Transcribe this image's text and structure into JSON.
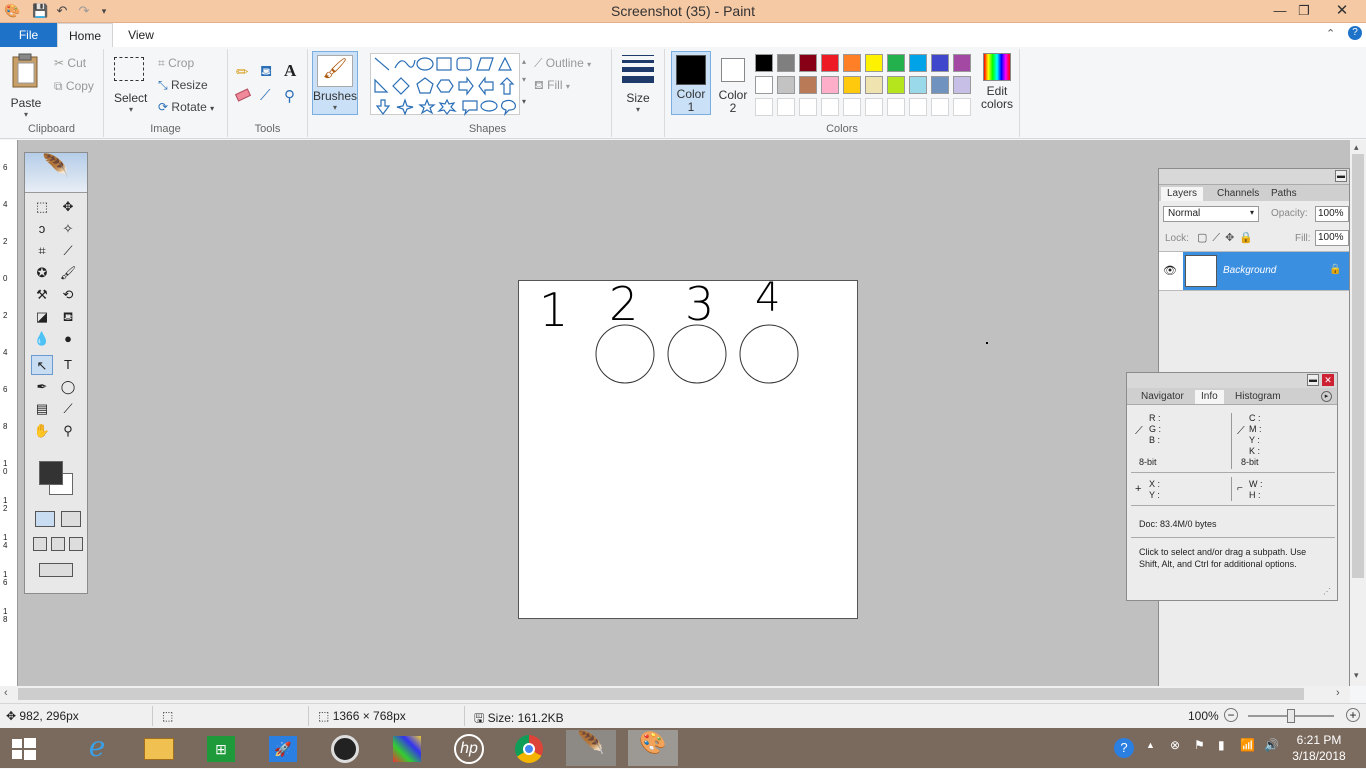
{
  "window": {
    "title": "Screenshot (35) - Paint"
  },
  "tabs": {
    "file": "File",
    "home": "Home",
    "view": "View"
  },
  "clipboard": {
    "paste": "Paste",
    "cut": "Cut",
    "copy": "Copy",
    "group": "Clipboard"
  },
  "image": {
    "select": "Select",
    "crop": "Crop",
    "resize": "Resize",
    "rotate": "Rotate",
    "group": "Image"
  },
  "tools": {
    "group": "Tools",
    "brushes": "Brushes"
  },
  "shapes": {
    "outline": "Outline",
    "fill": "Fill",
    "group": "Shapes"
  },
  "size": {
    "label": "Size"
  },
  "colors": {
    "color1_a": "Color",
    "color1_b": "1",
    "color2_a": "Color",
    "color2_b": "2",
    "edit_a": "Edit",
    "edit_b": "colors",
    "group": "Colors",
    "color1": "#000000",
    "color2": "#ffffff",
    "row1": [
      "#000000",
      "#7f7f7f",
      "#880015",
      "#ed1c24",
      "#ff7f27",
      "#fff200",
      "#22b14c",
      "#00a2e8",
      "#3f48cc",
      "#a349a4"
    ],
    "row2": [
      "#ffffff",
      "#c3c3c3",
      "#b97a57",
      "#ffaec9",
      "#ffc90e",
      "#efe4b0",
      "#b5e61d",
      "#99d9ea",
      "#7092be",
      "#c8bfe7"
    ]
  },
  "drawing": {
    "n1": "1",
    "n2": "2",
    "n3": "3",
    "n4": "4"
  },
  "ps_layers": {
    "tabs": [
      "Layers",
      "Channels",
      "Paths"
    ],
    "blend": "Normal",
    "opacity_label": "Opacity:",
    "opacity": "100%",
    "lock_label": "Lock:",
    "fill_label": "Fill:",
    "fill": "100%",
    "layer_name": "Background"
  },
  "ps_info": {
    "tabs": [
      "Navigator",
      "Info",
      "Histogram"
    ],
    "r": "R :",
    "g": "G :",
    "b": "B :",
    "bits1": "8-bit",
    "c": "C :",
    "m": "M :",
    "y": "Y :",
    "k": "K :",
    "bits2": "8-bit",
    "x": "X :",
    "yy": "Y :",
    "w": "W :",
    "h": "H :",
    "doc": "Doc: 83.4M/0 bytes",
    "hint": "Click to select and/or drag a subpath. Use Shift, Alt, and Ctrl for additional options."
  },
  "ruler": {
    "ticks": [
      "6",
      "4",
      "2",
      "0",
      "2",
      "4",
      "6",
      "8",
      "1 0",
      "1 2",
      "1 4",
      "1 6",
      "1 8"
    ]
  },
  "status": {
    "position": "982, 296px",
    "dimensions": "1366 × 768px",
    "size": "Size: 161.2KB",
    "zoom": "100%",
    "zoom_level": 0.5
  },
  "clock": {
    "time": "6:21 PM",
    "date": "3/18/2018"
  }
}
